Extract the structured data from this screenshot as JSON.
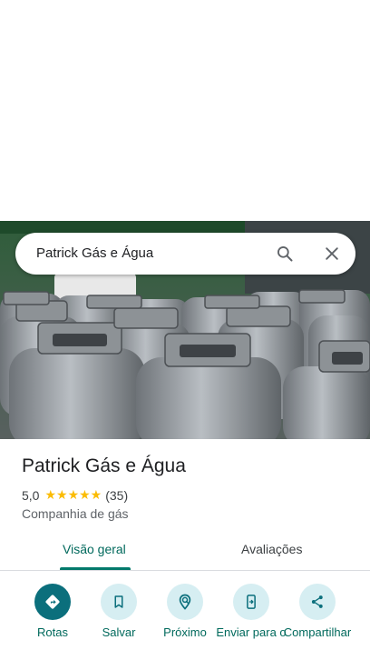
{
  "search": {
    "query": "Patrick Gás e Água"
  },
  "place": {
    "name": "Patrick Gás e Água",
    "rating": "5,0",
    "stars": "★★★★★",
    "review_count": "(35)",
    "category": "Companhia de gás"
  },
  "tabs": [
    {
      "label": "Visão geral",
      "active": true
    },
    {
      "label": "Avaliações",
      "active": false
    }
  ],
  "actions": [
    {
      "label": "Rotas",
      "icon": "directions-icon"
    },
    {
      "label": "Salvar",
      "icon": "bookmark-icon"
    },
    {
      "label": "Próximo",
      "icon": "nearby-icon"
    },
    {
      "label": "Enviar para o",
      "icon": "send-to-phone-icon"
    },
    {
      "label": "Compartilhar",
      "icon": "share-icon"
    }
  ],
  "colors": {
    "accent": "#00695c",
    "primary_action": "#0b6f7c",
    "action_bg": "#d6eef2",
    "star": "#fbbc04"
  }
}
